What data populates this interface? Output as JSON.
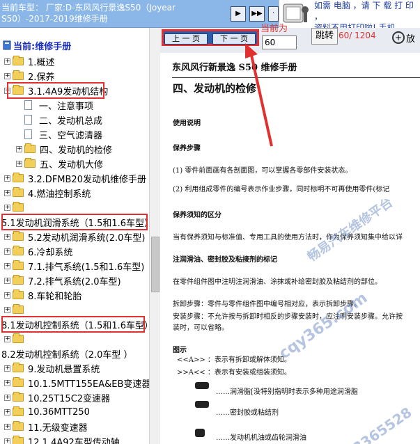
{
  "header": {
    "car_label": "当前车型： 厂家:D-东风风行景逸S50（Joyear\nS50）-2017-2019维修手册",
    "btn_prev_chapter": "▶",
    "btn_next_chapter": "▶▶",
    "ad_text": "如需 电脑 ，请 下 载 打 印 ，\n资料不用打印啦! 手机"
  },
  "tree": {
    "root": "当前:维修手册",
    "items": [
      {
        "text": "1.概述",
        "expander": "+",
        "indent": 0
      },
      {
        "text": "2.保养",
        "expander": "+",
        "indent": 0
      },
      {
        "text": "3.1.4A9发动机结构",
        "expander": "−",
        "indent": 0
      },
      {
        "text": "一、注意事项",
        "expander": "",
        "indent": 1,
        "icon": "doc"
      },
      {
        "text": "二、发动机总成",
        "expander": "",
        "indent": 1,
        "icon": "doc"
      },
      {
        "text": "三、空气滤清器",
        "expander": "",
        "indent": 1,
        "icon": "doc"
      },
      {
        "text": "四、发动机的检修",
        "expander": "+",
        "indent": 1
      },
      {
        "text": "五、发动机大修",
        "expander": "+",
        "indent": 1
      },
      {
        "text": "3.2.DFMB20发动机维修手册",
        "expander": "+",
        "indent": 0
      },
      {
        "text": "4.燃油控制系统",
        "expander": "+",
        "indent": 0
      },
      {
        "text": "",
        "expander": "+",
        "indent": 0
      },
      {
        "text": "5.1发动机润滑系统（1.5和1.6车型）",
        "expander": "",
        "indent": -1
      },
      {
        "text": "5.2发动机润滑系统(2.0车型)",
        "expander": "+",
        "indent": 0
      },
      {
        "text": "6.冷却系统",
        "expander": "+",
        "indent": 0
      },
      {
        "text": "7.1.排气系统(1.5和1.6车型)",
        "expander": "+",
        "indent": 0
      },
      {
        "text": "7.2.排气系统(2.0车型)",
        "expander": "+",
        "indent": 0
      },
      {
        "text": "8.车轮和轮胎",
        "expander": "+",
        "indent": 0
      },
      {
        "text": "",
        "expander": "+",
        "indent": 0
      },
      {
        "text": "8.1发动机控制系统（1.5和1.6车型）",
        "expander": "",
        "indent": -1
      },
      {
        "text": "",
        "expander": "+",
        "indent": 0
      },
      {
        "text": "8.2发动机控制系统（2.0车型 ）",
        "expander": "",
        "indent": -1
      },
      {
        "text": "9.发动机悬置系统",
        "expander": "+",
        "indent": 0
      },
      {
        "text": "10.1.5MTT155EA&EB变速器",
        "expander": "+",
        "indent": 0
      },
      {
        "text": "10.25T15C2变速器",
        "expander": "+",
        "indent": 0
      },
      {
        "text": "10.36MTT250",
        "expander": "+",
        "indent": 0
      },
      {
        "text": "11.无级变速器",
        "expander": "+",
        "indent": 0
      },
      {
        "text": "12.1.4A92车型传动轴",
        "expander": "+",
        "indent": 0
      }
    ]
  },
  "viewer": {
    "prev_page": "上 一 页",
    "next_page": "下 一 页",
    "current_label": "当前为",
    "page_value": "60",
    "jump": "跳转",
    "page_count": "60/ 1204",
    "zoom": "放"
  },
  "document": {
    "title": "东风风行新景逸 S50 维修手册",
    "section": "四、发动机的检修",
    "lines": [
      {
        "text": "使用说明",
        "bold": true
      },
      {
        "text": "保养步骤",
        "bold": true
      },
      {
        "text": "(1)  零件前面画有各剖面图，可以掌握各零部件安装状态。",
        "bold": false
      },
      {
        "text": "(2)  利用组成零件的编号表示作业步骤，同时标明不可再使用零件(标记",
        "bold": false
      },
      {
        "text": "保养须知的区分",
        "bold": true
      },
      {
        "text": "当有保养须知与标准值、专用工具的使用方法时，作为保养须知集中给以详",
        "bold": false
      },
      {
        "text": "注润滑油、密封胶及粘接剂的标记",
        "bold": true
      },
      {
        "text": "在零件组件图中注明注润滑油、涂抹或补给密封胶及粘结剂的部位。",
        "bold": false
      },
      {
        "text": "拆卸步骤：零件与零件组件图中编号相对应，表示拆卸步骤。",
        "bold": false
      },
      {
        "text": "安装步骤：不允许按与拆卸时相反的步骤安装时，应注明安装步骤。允许按",
        "bold": false
      },
      {
        "text": "          装时，可以省略。",
        "bold": false
      },
      {
        "text": "图示",
        "bold": true
      },
      {
        "text": "<<A>>  ：表示有拆卸或解体须知。",
        "bold": false
      },
      {
        "text": ">>A<<  ：表示有安装或组装须知。",
        "bold": false
      },
      {
        "text": "……润滑脂[没特别指明时表示多种用途润滑脂",
        "bold": false
      },
      {
        "text": "……密封胶或粘结剂",
        "bold": false
      },
      {
        "text": "……发动机机油或齿轮润滑油",
        "bold": false
      }
    ],
    "watermark_1": "畅易汽车维修平台",
    "watermark_2": "cqy365.com",
    "watermark_3": "3365528"
  }
}
